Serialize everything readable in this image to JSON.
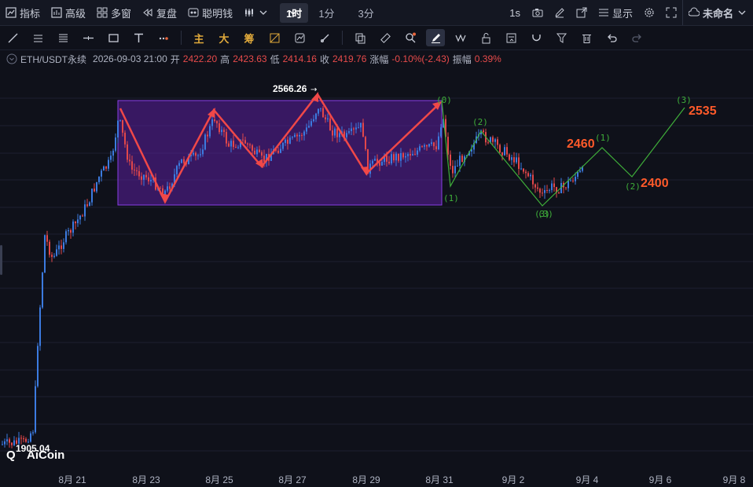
{
  "topbar": {
    "indicators": "指标",
    "advanced": "高级",
    "multi_window": "多窗",
    "replay": "复盘",
    "smart_money": "聪明钱",
    "timeframe_active": "1时",
    "tf_1m": "1分",
    "tf_3m": "3分",
    "interval_1s": "1s",
    "display": "显示",
    "layout_name": "未命名"
  },
  "toolbar": {
    "main_label": "主",
    "big_label": "大",
    "chips_label": "筹"
  },
  "info": {
    "symbol": "ETH/USDT永续",
    "datetime": "2026-09-03 21:00",
    "open_label": "开",
    "open": "2422.20",
    "high_label": "高",
    "high": "2423.63",
    "low_label": "低",
    "low": "2414.16",
    "close_label": "收",
    "close": "2419.76",
    "change_label": "涨幅",
    "change": "-0.10%(-2.43)",
    "amplitude_label": "振幅",
    "amplitude": "0.39%"
  },
  "chart": {
    "high_marker": "2566.26",
    "low_marker": "1905.04",
    "watermark": "AiCoin",
    "targets": [
      "2460",
      "2400",
      "2535"
    ],
    "wave_labels": [
      "(0)",
      "(1)",
      "(2)",
      "(3)",
      "(1)",
      "(2)",
      "(3)",
      "(3)"
    ],
    "x_labels": [
      "8月 21",
      "8月 23",
      "8月 25",
      "8月 27",
      "8月 29",
      "8月 31",
      "9月 2",
      "9月 4",
      "9月 6",
      "9月 8"
    ],
    "colors": {
      "up": "#3c7be0",
      "down": "#e2474a",
      "box": "#7b2fd6",
      "wave": "#3fae3a",
      "target": "#ff5a2a"
    }
  }
}
